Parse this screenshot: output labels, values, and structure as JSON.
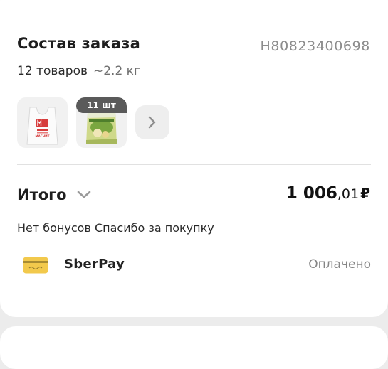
{
  "order": {
    "title": "Состав заказа",
    "number": "Н80823400698",
    "items_count": "12 товаров",
    "weight": "~2.2 кг",
    "items": [
      {
        "name": "Пакет Магнит",
        "icon": "shopping-bag-icon",
        "brand": "МАГНИТ"
      },
      {
        "name": "Товар",
        "icon": "product-package-icon",
        "quantity_badge": "11 шт"
      }
    ],
    "more_icon": "chevron-right-icon"
  },
  "total": {
    "label": "Итого",
    "chevron_icon": "chevron-down-icon",
    "amount_int": "1 006",
    "amount_cents": ",01",
    "currency": "₽"
  },
  "bonus": {
    "text": "Нет бонусов Спасибо за покупку"
  },
  "payment": {
    "icon": "bank-card-icon",
    "method": "SberPay",
    "status": "Оплачено"
  },
  "colors": {
    "background": "#ececec",
    "card": "#ffffff",
    "badge": "#5a5a5a",
    "card_icon": "#f2c94c"
  }
}
